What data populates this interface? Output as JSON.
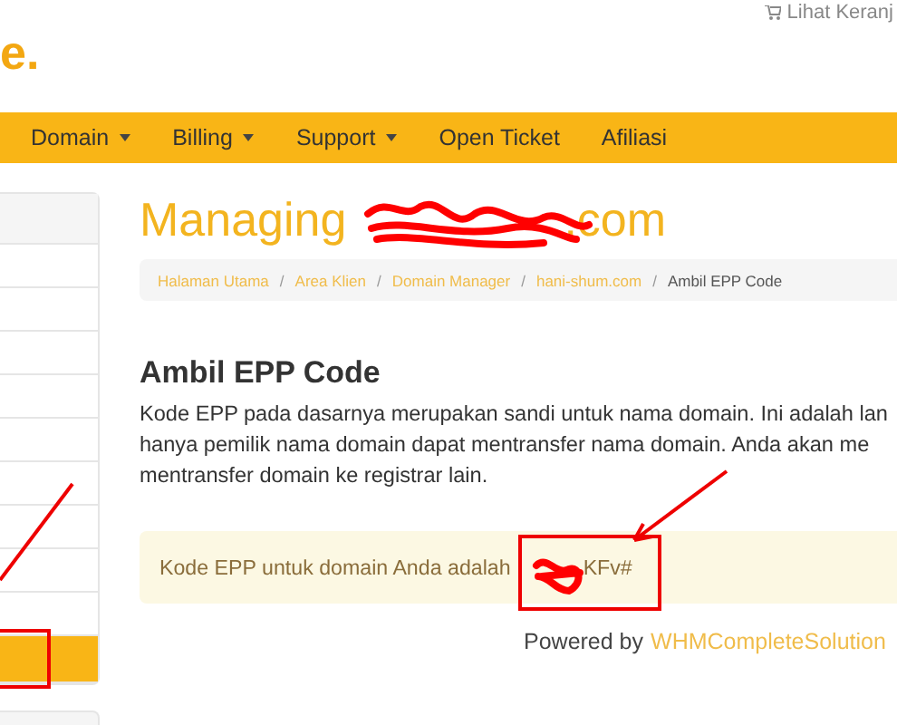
{
  "header": {
    "logo_fragment": "e.",
    "cart_link": "Lihat Keranj"
  },
  "nav": [
    {
      "label": "Domain",
      "has_caret": true
    },
    {
      "label": "Billing",
      "has_caret": true
    },
    {
      "label": "Support",
      "has_caret": true
    },
    {
      "label": "Open Ticket",
      "has_caret": false
    },
    {
      "label": "Afiliasi",
      "has_caret": false
    }
  ],
  "sidebar": {
    "items": [
      {
        "selected": false
      },
      {
        "selected": false
      },
      {
        "selected": false
      },
      {
        "selected": false
      },
      {
        "selected": false
      },
      {
        "selected": false
      },
      {
        "selected": false
      },
      {
        "selected": false
      },
      {
        "selected": false
      },
      {
        "selected": true
      }
    ]
  },
  "page_title": {
    "prefix": "Managing",
    "suffix": ".com"
  },
  "breadcrumb_separator": "/",
  "breadcrumb": [
    {
      "label": "Halaman Utama",
      "selected": false
    },
    {
      "label": "Area Klien",
      "selected": false
    },
    {
      "label": "Domain Manager",
      "selected": false
    },
    {
      "label": "hani-shum.com",
      "selected": false
    },
    {
      "label": "Ambil EPP Code",
      "selected": true
    }
  ],
  "section_heading": "Ambil EPP Code",
  "description_lines": [
    "Kode EPP pada dasarnya merupakan sandi untuk nama domain. Ini adalah lan",
    "hanya pemilik nama domain dapat mentransfer nama domain. Anda akan me",
    "mentransfer domain ke registrar lain."
  ],
  "epp_alert": {
    "text": "Kode EPP untuk domain Anda adalah",
    "code_visible": "KFv#"
  },
  "footer": {
    "prefix": "Powered by",
    "link": "WHMCompleteSolution"
  }
}
